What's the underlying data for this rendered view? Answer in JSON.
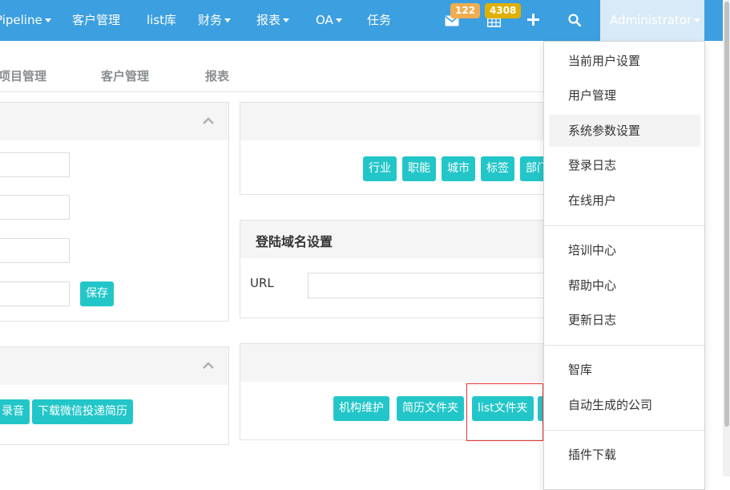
{
  "navbar": {
    "items": [
      {
        "label": "Pipeline",
        "dropdown": true
      },
      {
        "label": "客户管理",
        "dropdown": false
      },
      {
        "label": "list库",
        "dropdown": false
      },
      {
        "label": "财务",
        "dropdown": true
      },
      {
        "label": "报表",
        "dropdown": true
      },
      {
        "label": "OA",
        "dropdown": true
      },
      {
        "label": "任务",
        "dropdown": false
      }
    ],
    "mail_badge": "122",
    "calendar_badge": "4308",
    "user_menu_label": "Administrator",
    "colors": {
      "bar": "#3c9fe0",
      "mail_badge": "#f0ad4e",
      "calendar_badge": "#e0b000"
    }
  },
  "subnav": {
    "items": [
      "项目管理",
      "客户管理",
      "报表"
    ]
  },
  "left_panel_top": {
    "save_label": "保存"
  },
  "left_panel_bottom": {
    "buttons": [
      "录音",
      "下载微信投递简历"
    ]
  },
  "right_panel_top": {
    "buttons": [
      "行业",
      "职能",
      "城市",
      "标签",
      "部门"
    ]
  },
  "login_domain_panel": {
    "title": "登陆域名设置",
    "url_label": "URL",
    "url_value": ""
  },
  "right_panel_bottom": {
    "buttons": [
      "机构维护",
      "简历文件夹",
      "list文件夹"
    ]
  },
  "dropdown_menu": {
    "groups": [
      [
        "当前用户设置",
        "用户管理",
        "系统参数设置",
        "登录日志",
        "在线用户"
      ],
      [
        "培训中心",
        "帮助中心",
        "更新日志"
      ],
      [
        "智库",
        "自动生成的公司"
      ],
      [
        "插件下载"
      ]
    ],
    "highlighted": "系统参数设置"
  },
  "accent_color": "#23c6c8"
}
